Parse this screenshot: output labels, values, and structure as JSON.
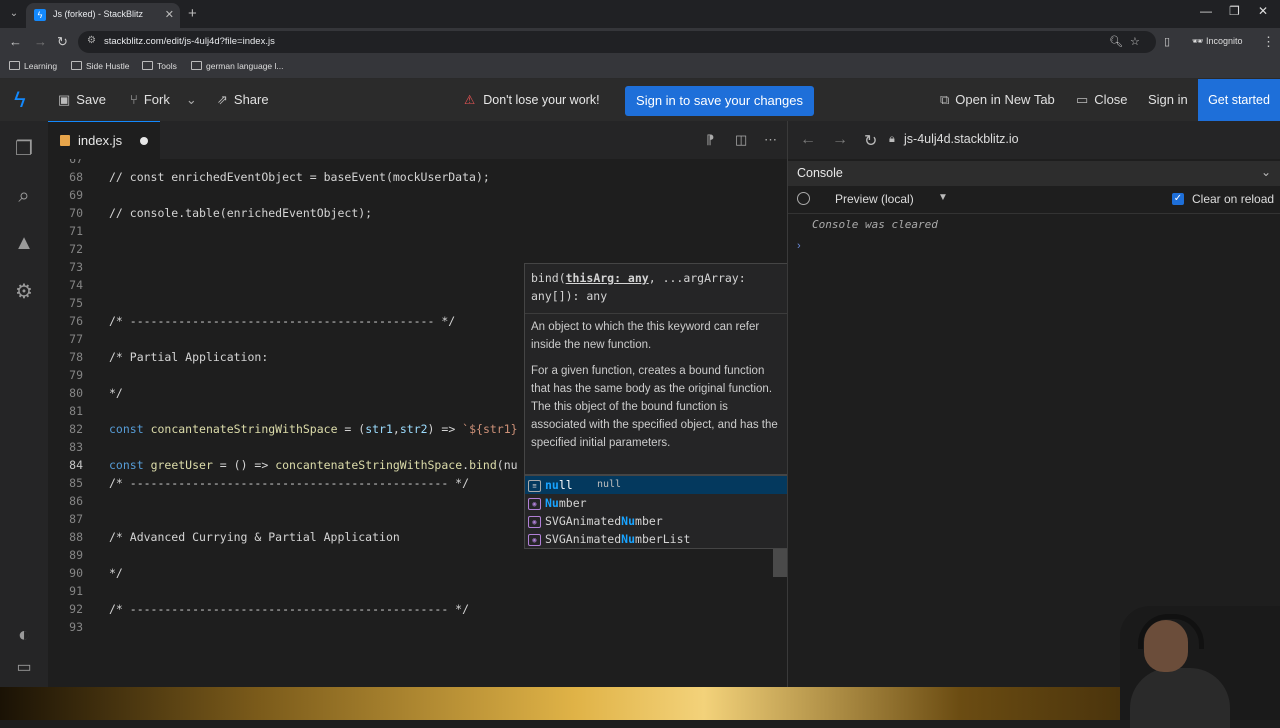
{
  "browser": {
    "tab_title": "Js (forked) - StackBlitz",
    "url": "stackblitz.com/edit/js-4ulj4d?file=index.js",
    "profile": "Incognito",
    "bookmarks": [
      "Learning",
      "Side Hustle",
      "Tools",
      "german language l..."
    ]
  },
  "header": {
    "save": "Save",
    "fork": "Fork",
    "share": "Share",
    "warning": "Don't lose your work!",
    "signin_save": "Sign in to save your changes",
    "open_new_tab": "Open in New Tab",
    "close": "Close",
    "signin": "Sign in",
    "get_started": "Get started"
  },
  "editor": {
    "filename": "index.js",
    "lines": [
      {
        "n": "68",
        "code": "// const enrichedEventObject = baseEvent(mockUserData);"
      },
      {
        "n": "69",
        "code": ""
      },
      {
        "n": "70",
        "code": "// console.table(enrichedEventObject);"
      },
      {
        "n": "71",
        "code": ""
      },
      {
        "n": "72",
        "code": ""
      },
      {
        "n": "73",
        "code": ""
      },
      {
        "n": "74",
        "code": ""
      },
      {
        "n": "75",
        "code": ""
      },
      {
        "n": "76",
        "code": "/* -------------------------------------------- */"
      },
      {
        "n": "77",
        "code": ""
      },
      {
        "n": "78",
        "code": "/* Partial Application:"
      },
      {
        "n": "79",
        "code": ""
      },
      {
        "n": "80",
        "code": "*/"
      },
      {
        "n": "81",
        "code": ""
      },
      {
        "n": "82",
        "code": "const concantenateStringWithSpace = (str1,str2) => `${str1}"
      },
      {
        "n": "83",
        "code": ""
      },
      {
        "n": "84",
        "code": "const greetUser = () => concantenateStringWithSpace.bind(nu"
      },
      {
        "n": "85",
        "code": "/* ---------------------------------------------- */"
      },
      {
        "n": "86",
        "code": ""
      },
      {
        "n": "87",
        "code": "/* ---------------------------------------------- */"
      },
      {
        "n": "88",
        "code": "/* Advanced Currying & Partial Application"
      },
      {
        "n": "89",
        "code": ""
      },
      {
        "n": "90",
        "code": "*/"
      },
      {
        "n": "91",
        "code": ""
      },
      {
        "n": "92",
        "code": "/* ---------------------------------------------- */"
      },
      {
        "n": "93",
        "code": ""
      }
    ]
  },
  "hover": {
    "signature_prefix": "bind(",
    "signature_param": "thisArg: any",
    "signature_rest": ", ...argArray: any[]): any",
    "param_doc": "An object to which the this keyword can refer inside the new function.",
    "description": "For a given function, creates a bound function that has the same body as the original function. The this object of the bound function is associated with the specified object, and has the specified initial parameters."
  },
  "suggest": [
    {
      "label": "null",
      "detail": "null"
    },
    {
      "label": "Number",
      "detail": ""
    },
    {
      "label": "SVGAnimatedNumber",
      "detail": ""
    },
    {
      "label": "SVGAnimatedNumberList",
      "detail": ""
    }
  ],
  "preview": {
    "url": "js-4ulj4d.stackblitz.io",
    "console_title": "Console",
    "context": "Preview (local)",
    "clear_on_reload": "Clear on reload",
    "cleared_msg": "Console was cleared"
  }
}
